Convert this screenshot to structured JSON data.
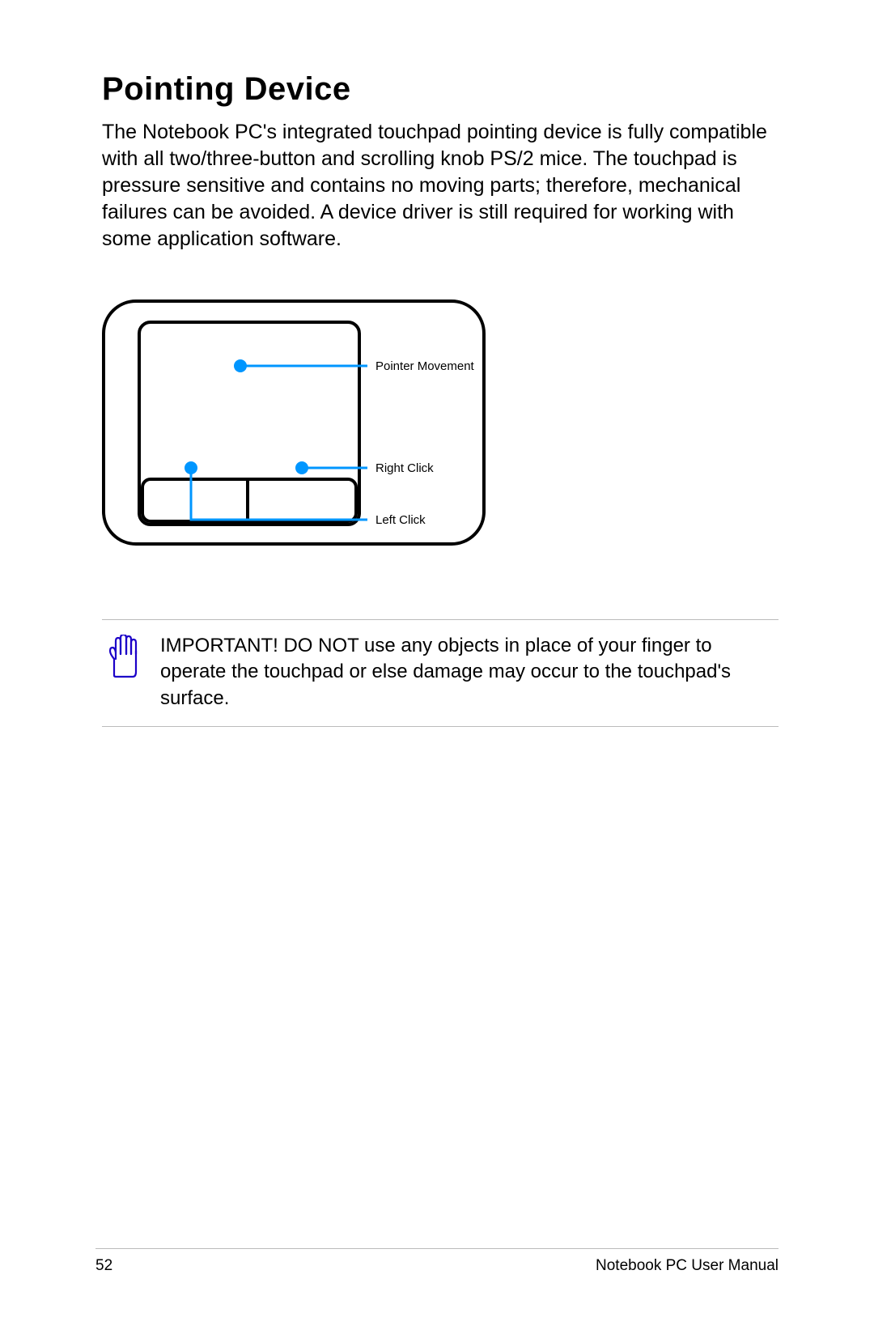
{
  "title": "Pointing Device",
  "body": "The Notebook PC's integrated touchpad pointing device is fully compatible with all two/three-button and scrolling knob PS/2 mice. The touchpad is pressure sensitive and contains no moving parts; therefore, mechanical failures can be avoided. A device driver is still required for working with some application software.",
  "diagram": {
    "labels": {
      "pointer_movement": "Pointer Movement",
      "right_click": "Right Click",
      "left_click": "Left Click"
    }
  },
  "callout": {
    "icon_name": "hand-stop-icon",
    "text": "IMPORTANT! DO NOT use any objects in place of your finger to operate the touchpad or else damage may occur to the touchpad's surface."
  },
  "footer": {
    "page_number": "52",
    "manual_name": "Notebook PC User Manual"
  },
  "colors": {
    "accent": "#0096FF",
    "hand_icon": "#1C00C8"
  }
}
